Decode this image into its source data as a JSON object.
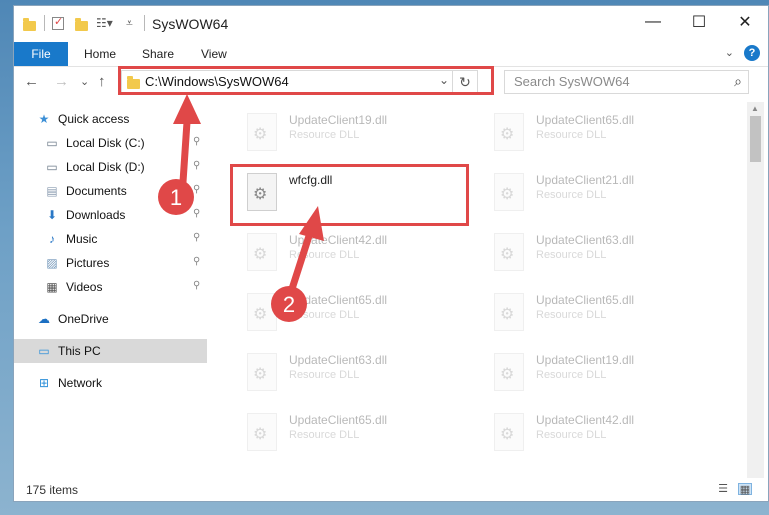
{
  "window": {
    "title": "SysWOW64",
    "controls": {
      "minimize": "—",
      "maximize": "☐",
      "close": "✕"
    }
  },
  "ribbon": {
    "tabs": [
      {
        "label": "File"
      },
      {
        "label": "Home"
      },
      {
        "label": "Share"
      },
      {
        "label": "View"
      }
    ],
    "expand_icon": "⌄",
    "help_icon": "?"
  },
  "navigation": {
    "back": "←",
    "forward": "→",
    "recent": "⌄",
    "up": "↑",
    "address": "C:\\Windows\\SysWOW64",
    "address_dropdown": "⌄",
    "refresh": "↻",
    "search_placeholder": "Search SysWOW64",
    "search_icon": "⌕"
  },
  "sidebar": {
    "items": [
      {
        "label": "Quick access",
        "icon": "star-icon",
        "glyph": "★",
        "color": "#3c8fd6",
        "pinned": false
      },
      {
        "label": "Local Disk (C:)",
        "icon": "drive-icon",
        "glyph": "▭",
        "color": "#6b7a88",
        "pinned": true
      },
      {
        "label": "Local Disk (D:)",
        "icon": "drive-icon",
        "glyph": "▭",
        "color": "#6b7a88",
        "pinned": true
      },
      {
        "label": "Documents",
        "icon": "document-icon",
        "glyph": "▤",
        "color": "#8a9bb0",
        "pinned": true
      },
      {
        "label": "Downloads",
        "icon": "download-icon",
        "glyph": "⬇",
        "color": "#2a78c6",
        "pinned": true
      },
      {
        "label": "Music",
        "icon": "music-icon",
        "glyph": "♪",
        "color": "#2a78c6",
        "pinned": true
      },
      {
        "label": "Pictures",
        "icon": "pictures-icon",
        "glyph": "▨",
        "color": "#6f94b8",
        "pinned": true
      },
      {
        "label": "Videos",
        "icon": "video-icon",
        "glyph": "▦",
        "color": "#555555",
        "pinned": true
      },
      {
        "label": "OneDrive",
        "icon": "cloud-icon",
        "glyph": "☁",
        "color": "#1b6fc2",
        "pinned": false
      },
      {
        "label": "This PC",
        "icon": "computer-icon",
        "glyph": "▭",
        "color": "#2d8fd9",
        "pinned": false,
        "selected": true
      },
      {
        "label": "Network",
        "icon": "network-icon",
        "glyph": "⊞",
        "color": "#2d8fd9",
        "pinned": false
      }
    ],
    "pin_glyph": "📌"
  },
  "files": {
    "left": [
      {
        "name": "UpdateClient19.dll",
        "type": "Resource DLL",
        "faded": true
      },
      {
        "name": "wfcfg.dll",
        "type": "",
        "faded": false
      },
      {
        "name": "UpdateClient42.dll",
        "type": "Resource DLL",
        "faded": true
      },
      {
        "name": "UpdateClient65.dll",
        "type": "Resource DLL",
        "faded": true
      },
      {
        "name": "UpdateClient63.dll",
        "type": "Resource DLL",
        "faded": true
      },
      {
        "name": "UpdateClient65.dll",
        "type": "Resource DLL",
        "faded": true
      }
    ],
    "right": [
      {
        "name": "UpdateClient65.dll",
        "type": "Resource DLL",
        "faded": true
      },
      {
        "name": "UpdateClient21.dll",
        "type": "Resource DLL",
        "faded": true
      },
      {
        "name": "UpdateClient63.dll",
        "type": "Resource DLL",
        "faded": true
      },
      {
        "name": "UpdateClient65.dll",
        "type": "Resource DLL",
        "faded": true
      },
      {
        "name": "UpdateClient19.dll",
        "type": "Resource DLL",
        "faded": true
      },
      {
        "name": "UpdateClient42.dll",
        "type": "Resource DLL",
        "faded": true
      }
    ]
  },
  "status": {
    "item_count": "175 items",
    "view_details": "☰",
    "view_tiles": "▦"
  },
  "annotations": {
    "step1": "1",
    "step2": "2",
    "color": "#e04848"
  }
}
